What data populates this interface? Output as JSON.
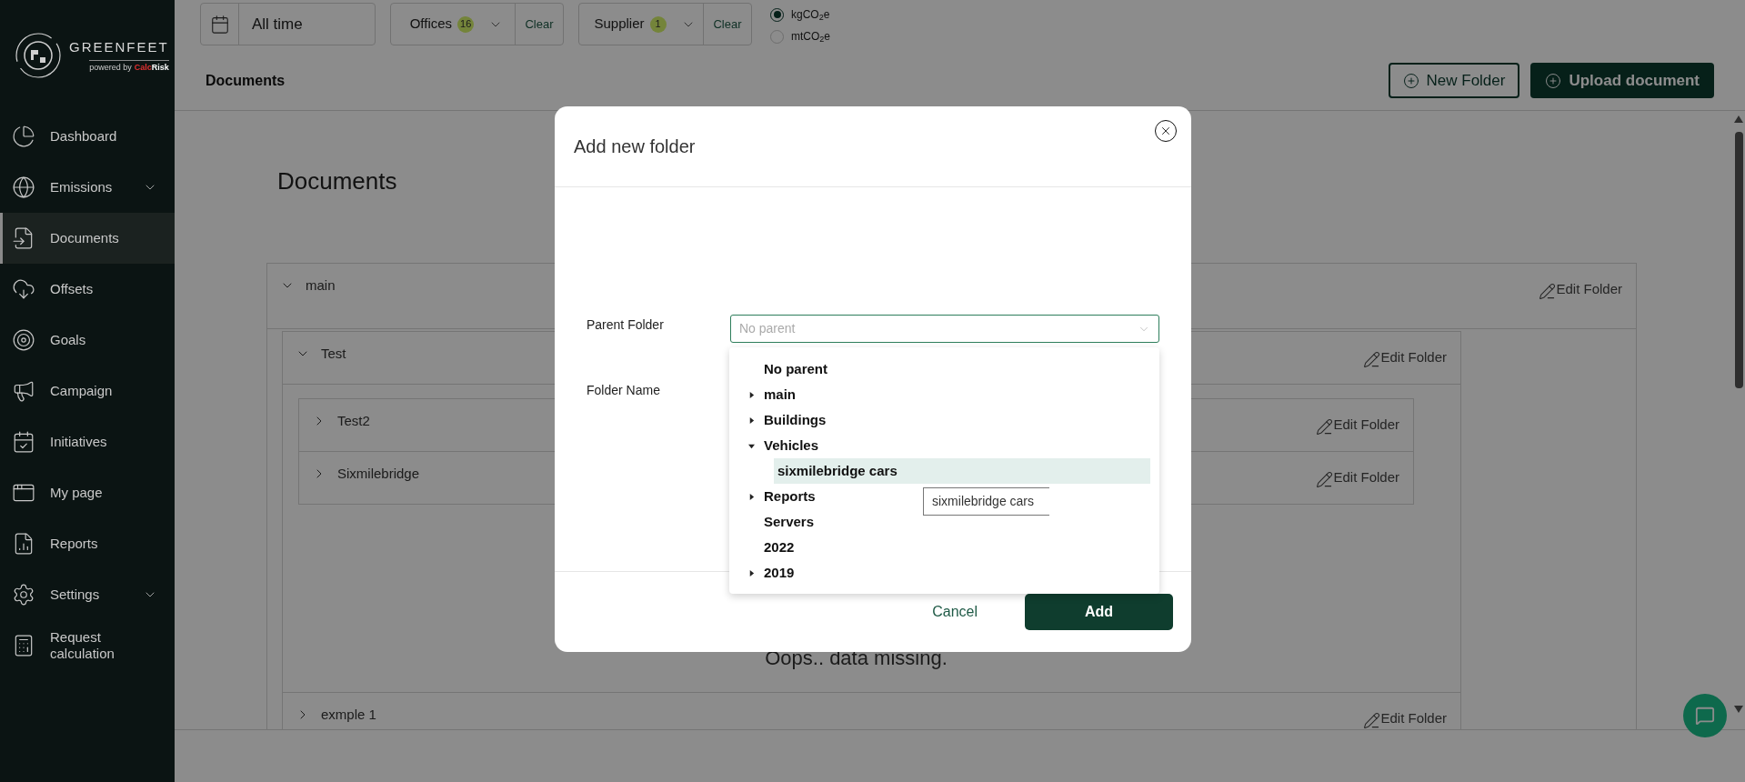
{
  "sidebar": {
    "logo": {
      "name": "GREENFEET",
      "powered_by": "powered by",
      "brand_parts": [
        "Calc",
        "Risk"
      ]
    },
    "items": [
      {
        "label": "Dashboard",
        "selected": false,
        "expandable": false
      },
      {
        "label": "Emissions",
        "selected": false,
        "expandable": true
      },
      {
        "label": "Documents",
        "selected": true,
        "expandable": false
      },
      {
        "label": "Offsets",
        "selected": false,
        "expandable": false
      },
      {
        "label": "Goals",
        "selected": false,
        "expandable": false
      },
      {
        "label": "Campaign",
        "selected": false,
        "expandable": false
      },
      {
        "label": "Initiatives",
        "selected": false,
        "expandable": false
      },
      {
        "label": "My page",
        "selected": false,
        "expandable": false
      },
      {
        "label": "Reports",
        "selected": false,
        "expandable": false
      },
      {
        "label": "Settings",
        "selected": false,
        "expandable": true
      },
      {
        "label": "Request calculation",
        "selected": false,
        "expandable": false
      }
    ]
  },
  "filters": {
    "date": {
      "value": "All time"
    },
    "dropdowns": [
      {
        "label": "Offices",
        "count": "16",
        "clear": "Clear"
      },
      {
        "label": "Supplier",
        "count": "1",
        "clear": "Clear"
      }
    ],
    "units": [
      {
        "label": "kgCO$_{2}$e",
        "selected": true
      },
      {
        "label": "mtCO$_{2}$e",
        "selected": false
      }
    ]
  },
  "header": {
    "title": "Documents",
    "buttons": [
      {
        "label": "New Folder",
        "kind": "outline"
      },
      {
        "label": "Upload document",
        "kind": "primary"
      }
    ]
  },
  "content": {
    "title": "Documents",
    "folders": [
      {
        "name": "main",
        "expanded": true,
        "edit": "Edit Folder",
        "children": [
          {
            "name": "Test",
            "expanded": true,
            "edit": "Edit Folder",
            "message": "Oops.. data missing.",
            "children": [
              {
                "name": "Test2",
                "expanded": false,
                "edit": "Edit Folder"
              },
              {
                "name": "Sixmilebridge",
                "expanded": false,
                "edit": "Edit Folder"
              }
            ]
          },
          {
            "name": "exmple 1",
            "expanded": false,
            "edit": "Edit Folder"
          }
        ]
      }
    ]
  },
  "modal": {
    "title": "Add new folder",
    "parent_field": {
      "label": "Parent Folder",
      "placeholder": "No parent"
    },
    "name_field": {
      "label": "Folder Name"
    },
    "options": [
      {
        "label": "No parent",
        "kind": "leaf",
        "selected": false
      },
      {
        "label": "main",
        "kind": "branch",
        "expanded": false,
        "selected": false
      },
      {
        "label": "Buildings",
        "kind": "branch",
        "expanded": false,
        "selected": false
      },
      {
        "label": "Vehicles",
        "kind": "branch",
        "expanded": true,
        "selected": false,
        "children": [
          {
            "label": "sixmilebridge cars",
            "selected": true
          }
        ]
      },
      {
        "label": "Reports",
        "kind": "branch",
        "expanded": false,
        "selected": false
      },
      {
        "label": "Servers",
        "kind": "leaf",
        "selected": false
      },
      {
        "label": "2022",
        "kind": "leaf",
        "selected": false
      },
      {
        "label": "2019",
        "kind": "branch",
        "expanded": false,
        "selected": false
      }
    ],
    "tooltip": "sixmilebridge cars",
    "buttons": [
      {
        "label": "Cancel",
        "kind": "text"
      },
      {
        "label": "Add",
        "kind": "primary"
      }
    ]
  }
}
